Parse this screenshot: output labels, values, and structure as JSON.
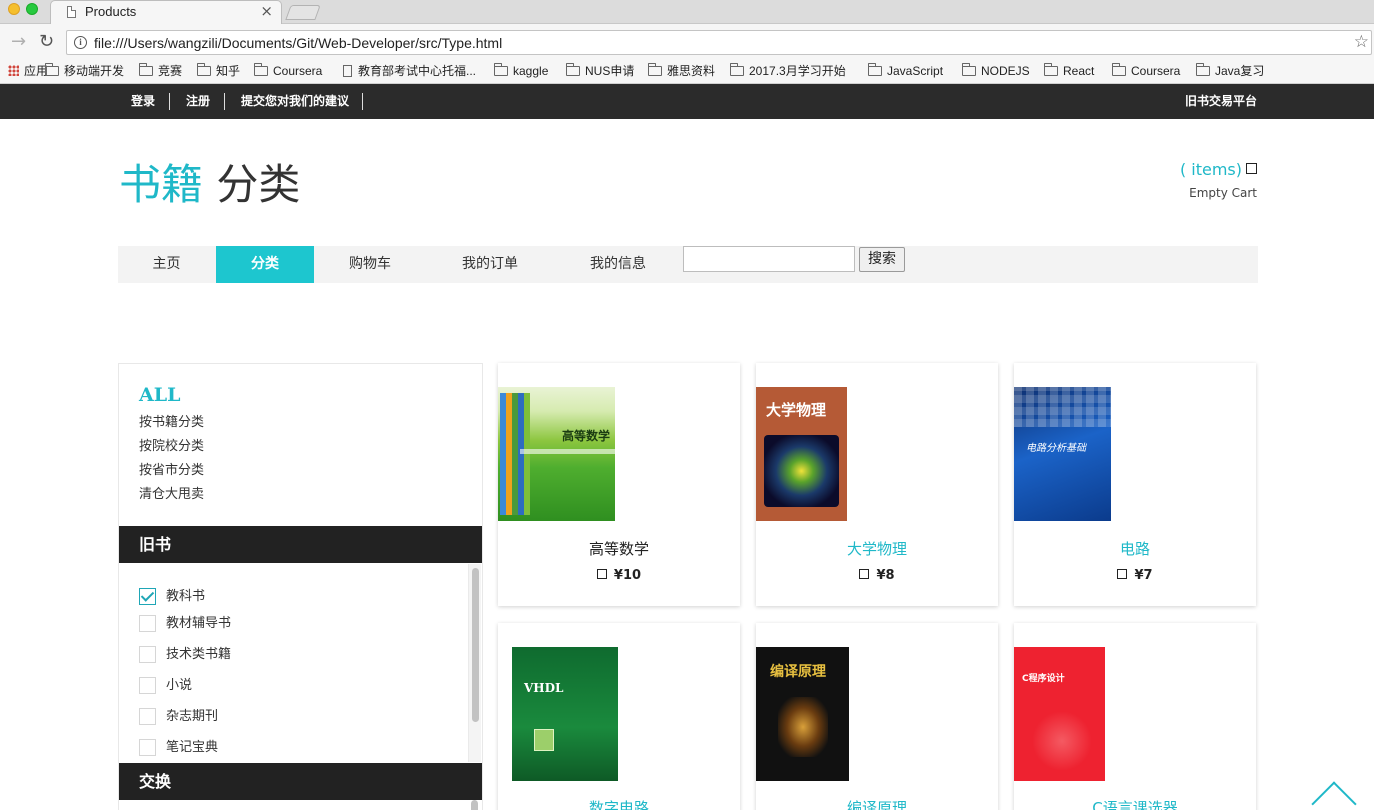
{
  "browser": {
    "tab_title": "Products",
    "url": "file:///Users/wangzili/Documents/Git/Web-Developer/src/Type.html",
    "bookmarks": [
      {
        "label": "应用",
        "kind": "apps"
      },
      {
        "label": "移动端开发",
        "kind": "folder"
      },
      {
        "label": "竞赛",
        "kind": "folder"
      },
      {
        "label": "知乎",
        "kind": "folder"
      },
      {
        "label": "Coursera",
        "kind": "folder"
      },
      {
        "label": "教育部考试中心托福...",
        "kind": "page"
      },
      {
        "label": "kaggle",
        "kind": "folder"
      },
      {
        "label": "NUS申请",
        "kind": "folder"
      },
      {
        "label": "雅思资料",
        "kind": "folder"
      },
      {
        "label": "2017.3月学习开始",
        "kind": "folder"
      },
      {
        "label": "JavaScript",
        "kind": "folder"
      },
      {
        "label": "NODEJS",
        "kind": "folder"
      },
      {
        "label": "React",
        "kind": "folder"
      },
      {
        "label": "Coursera",
        "kind": "folder"
      },
      {
        "label": "Java复习",
        "kind": "folder"
      }
    ]
  },
  "topbar": {
    "links": [
      "登录",
      "注册",
      "提交您对我们的建议"
    ],
    "platform": "旧书交易平台"
  },
  "header": {
    "logo_accent": "书籍",
    "logo_main": "分类",
    "cart_items": "( items)",
    "cart_empty": "Empty Cart"
  },
  "nav": {
    "items": [
      {
        "label": "主页",
        "active": false
      },
      {
        "label": "分类",
        "active": true
      },
      {
        "label": "购物车",
        "active": false
      },
      {
        "label": "我的订单",
        "active": false
      },
      {
        "label": "我的信息",
        "active": false
      }
    ],
    "search_value": "",
    "search_button": "搜索"
  },
  "sidebar": {
    "all_label": "ALL",
    "category_links": [
      "按书籍分类",
      "按院校分类",
      "按省市分类",
      "清仓大甩卖"
    ],
    "used_books_heading": "旧书",
    "filters": [
      {
        "label": "教科书",
        "checked": true
      },
      {
        "label": "教材辅导书",
        "checked": false
      },
      {
        "label": "技术类书籍",
        "checked": false
      },
      {
        "label": "小说",
        "checked": false
      },
      {
        "label": "杂志期刊",
        "checked": false
      },
      {
        "label": "笔记宝典",
        "checked": false
      }
    ],
    "exchange_heading": "交换"
  },
  "products": [
    {
      "name": "高等数学",
      "price": "¥10",
      "highlight": false,
      "cover_text": "高等数学"
    },
    {
      "name": "大学物理",
      "price": "¥8",
      "highlight": true,
      "cover_text": "大学物理"
    },
    {
      "name": "电路",
      "price": "¥7",
      "highlight": true,
      "cover_text": "电路分析基础"
    },
    {
      "name": "数字电路",
      "price": "",
      "highlight": true,
      "cover_text": "VHDL"
    },
    {
      "name": "编译原理",
      "price": "",
      "highlight": true,
      "cover_text": "编译原理"
    },
    {
      "name": "C语言课选器",
      "price": "",
      "highlight": true,
      "cover_text": "C程序设计"
    }
  ],
  "colors": {
    "accent": "#1fb8c8",
    "nav_active": "#1dc6cf",
    "topbar_bg": "#2b2b2b",
    "section_head_bg": "#222222"
  }
}
